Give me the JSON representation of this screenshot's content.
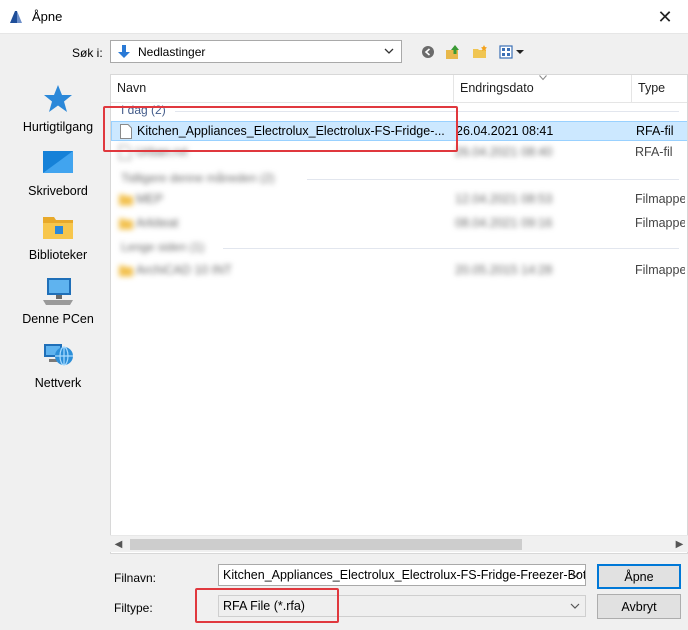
{
  "window": {
    "title": "Åpne",
    "close_glyph": "✕"
  },
  "lookin": {
    "label": "Søk i:",
    "value": "Nedlastinger"
  },
  "toolbar": {
    "icons": [
      "back-icon",
      "up-folder-icon",
      "new-folder-icon",
      "view-menu-icon"
    ]
  },
  "places": [
    {
      "label": "Hurtigtilgang",
      "icon": "star-icon"
    },
    {
      "label": "Skrivebord",
      "icon": "desktop-icon"
    },
    {
      "label": "Biblioteker",
      "icon": "libraries-icon"
    },
    {
      "label": "Denne PCen",
      "icon": "computer-icon"
    },
    {
      "label": "Nettverk",
      "icon": "network-icon"
    }
  ],
  "columns": {
    "name": "Navn",
    "date": "Endringsdato",
    "type": "Type"
  },
  "groups": [
    {
      "label": "I dag (2)"
    },
    {
      "label": "Tidligere denne måneden (2)"
    },
    {
      "label": "Lenge siden (1)"
    }
  ],
  "rows": [
    {
      "name": "Kitchen_Appliances_Electrolux_Electrolux-FS-Fridge-...",
      "date": "26.04.2021 08:41",
      "type": "RFA-fil"
    },
    {
      "name": "Urban.rvt",
      "date": "26.04.2021 08:40",
      "type": "RFA-fil"
    },
    {
      "name": "MEP",
      "date": "12.04.2021 08:53",
      "type": "Filmappe"
    },
    {
      "name": "Arkiteat",
      "date": "08.04.2021 09:16",
      "type": "Filmappe"
    },
    {
      "name": "ArchiCAD 10 INT",
      "date": "20.05.2015 14:28",
      "type": "Filmappe"
    }
  ],
  "filename": {
    "label": "Filnavn:",
    "value": "Kitchen_Appliances_Electrolux_Electrolux-FS-Fridge-Freezer-Bott"
  },
  "filetype": {
    "label": "Filtype:",
    "value": "RFA File (*.rfa)"
  },
  "buttons": {
    "open": "Åpne",
    "cancel": "Avbryt"
  },
  "colors": {
    "selection": "#cce8ff",
    "highlight": "#e0383e",
    "accent": "#0078d7"
  }
}
